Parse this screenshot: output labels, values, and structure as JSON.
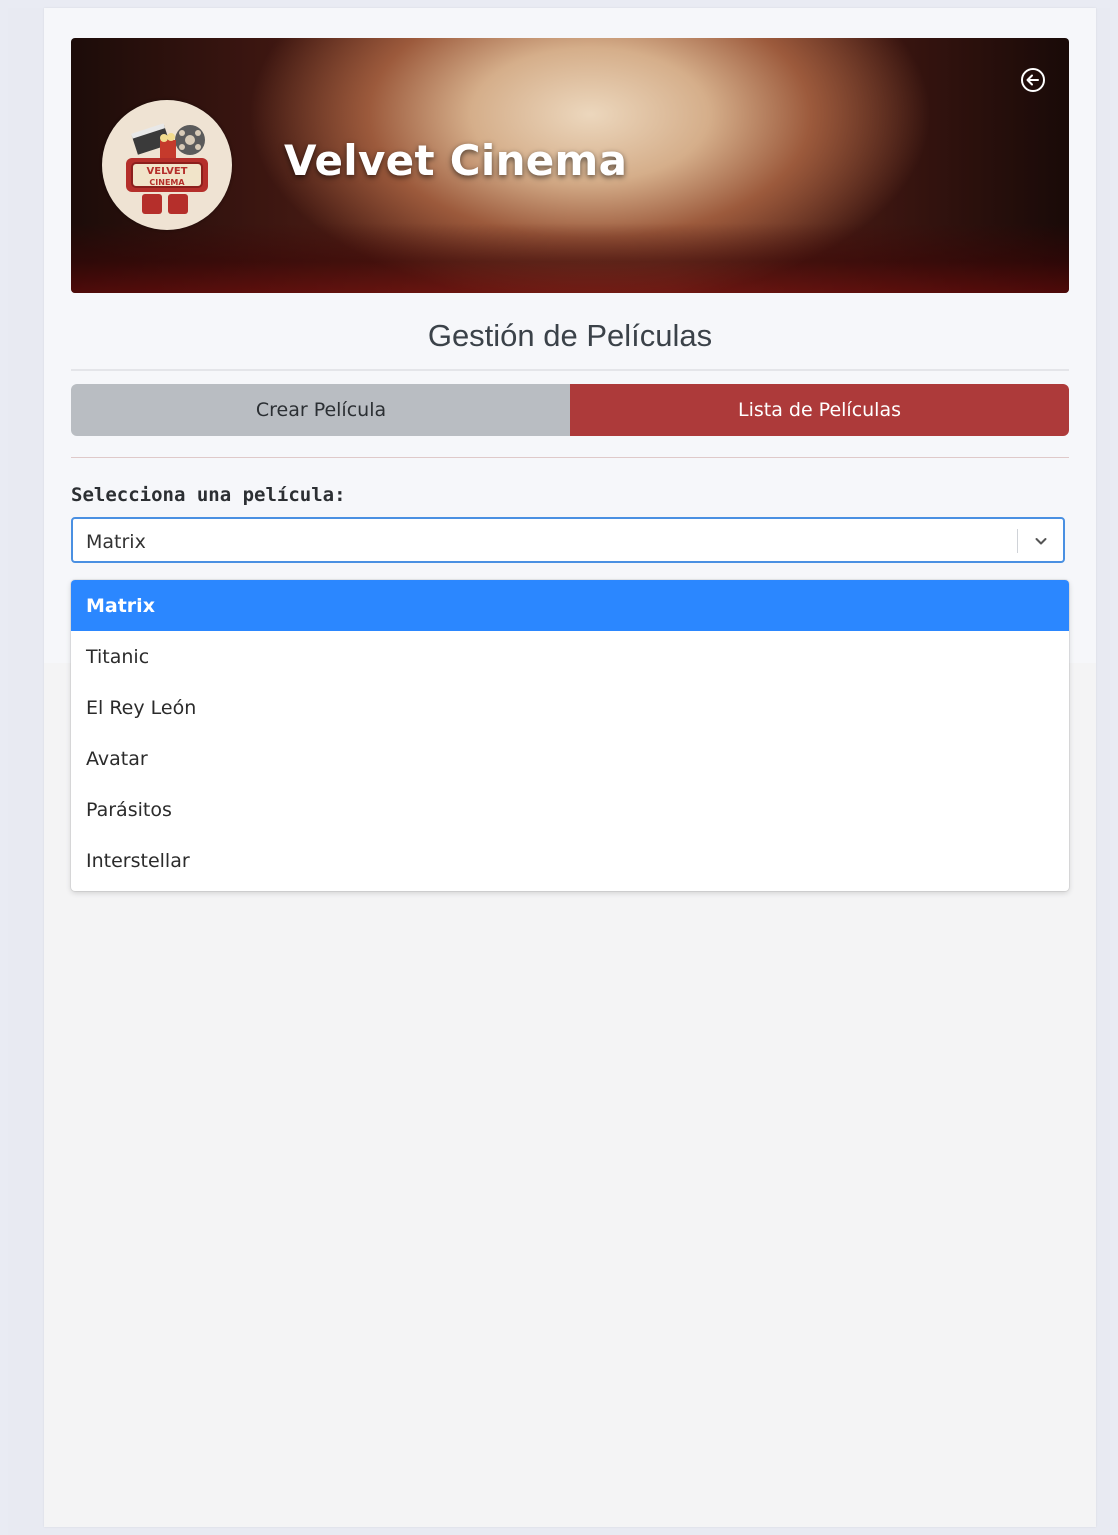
{
  "banner": {
    "title": "Velvet Cinema",
    "logo_text_top": "VELVET",
    "logo_text_bottom": "CINEMA",
    "back_icon": "arrow-left-circle-icon"
  },
  "page": {
    "section_title": "Gestión de Películas"
  },
  "tabs": [
    {
      "label": "Crear Película",
      "active": false
    },
    {
      "label": "Lista de Películas",
      "active": true
    }
  ],
  "movie_select": {
    "label": "Selecciona una película:",
    "value": "Matrix",
    "chevron_icon": "chevron-down-icon",
    "options": [
      "Matrix",
      "Titanic",
      "El Rey León",
      "Avatar",
      "Parásitos",
      "Interstellar"
    ],
    "selected_index": 0
  },
  "colors": {
    "accent_red": "#ad3a3a",
    "tab_inactive": "#b9bdc2",
    "focus_blue": "#4a90e2",
    "highlight_blue": "#2b87ff"
  }
}
